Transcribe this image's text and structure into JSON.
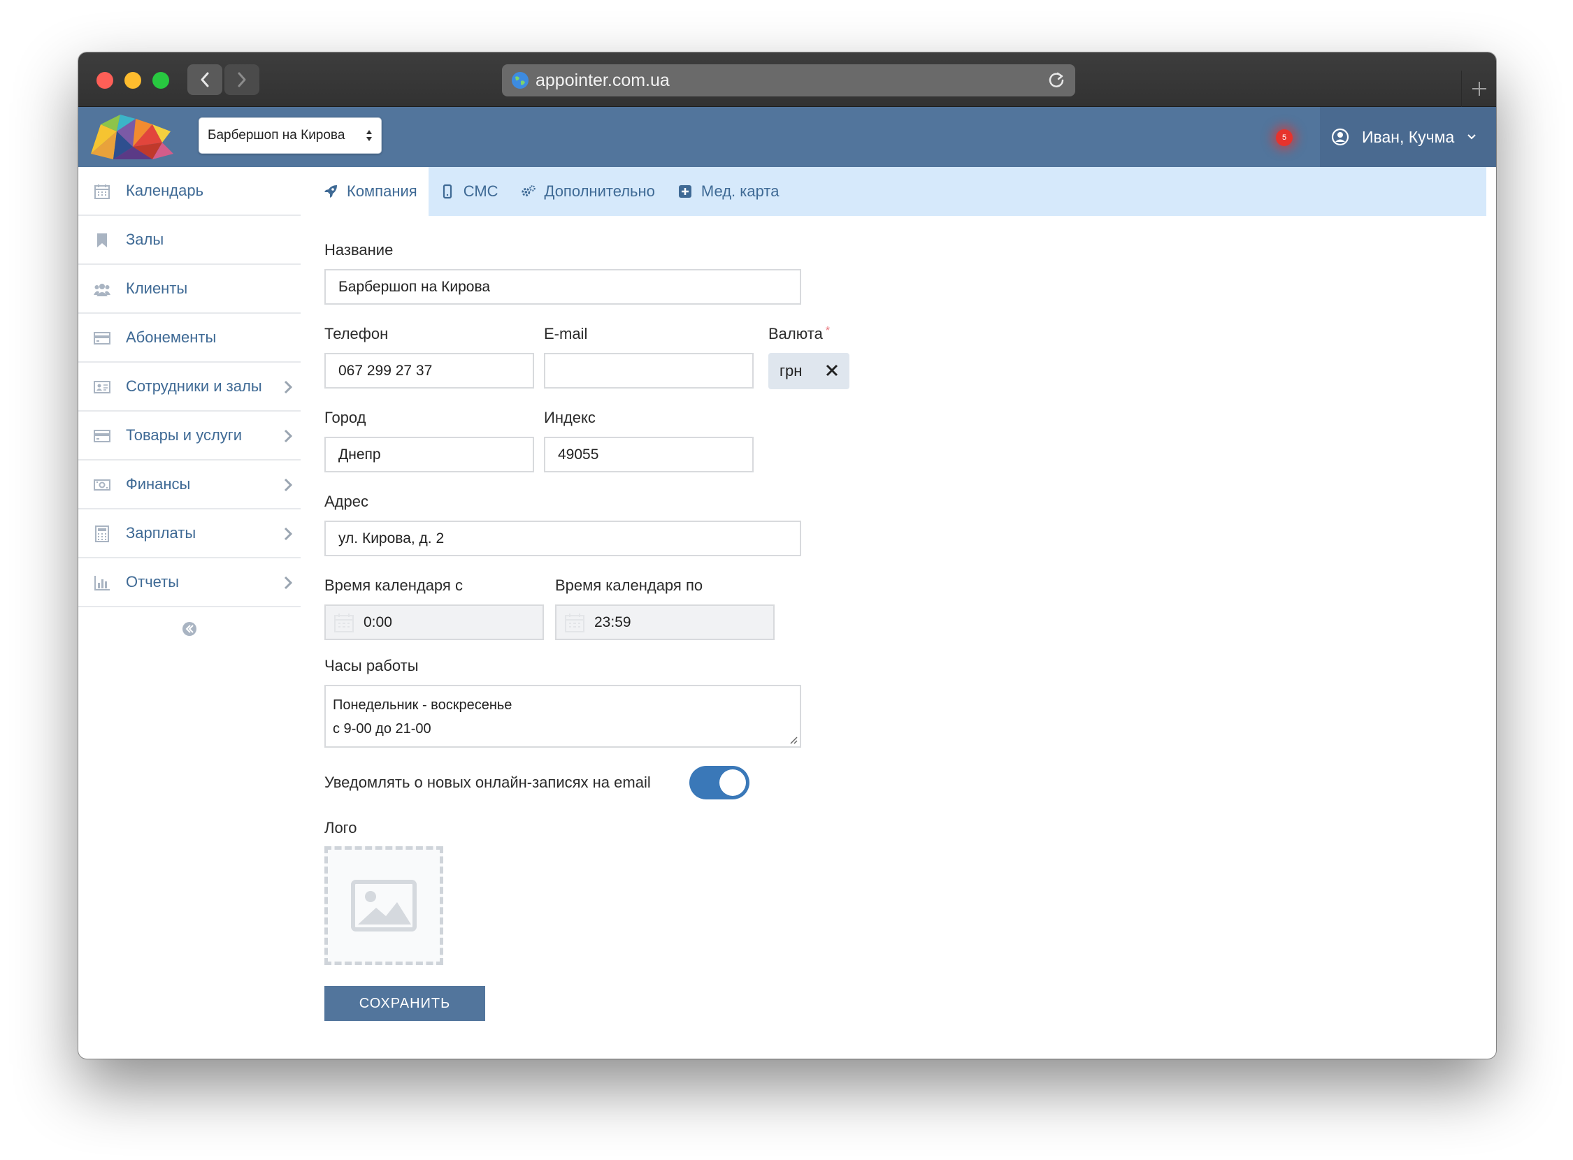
{
  "browser": {
    "url": "appointer.com.ua"
  },
  "header": {
    "company_select": "Барбершоп на Кирова",
    "notification_count": "5",
    "user_name": "Иван, Кучма"
  },
  "sidebar": {
    "items": [
      {
        "label": "Календарь",
        "icon": "calendar-icon",
        "has_arrow": false
      },
      {
        "label": "Залы",
        "icon": "bookmark-icon",
        "has_arrow": false
      },
      {
        "label": "Клиенты",
        "icon": "users-icon",
        "has_arrow": false
      },
      {
        "label": "Абонементы",
        "icon": "card-icon",
        "has_arrow": false
      },
      {
        "label": "Сотрудники и залы",
        "icon": "id-card-icon",
        "has_arrow": true
      },
      {
        "label": "Товары и услуги",
        "icon": "card-icon",
        "has_arrow": true
      },
      {
        "label": "Финансы",
        "icon": "money-icon",
        "has_arrow": true
      },
      {
        "label": "Зарплаты",
        "icon": "calculator-icon",
        "has_arrow": true
      },
      {
        "label": "Отчеты",
        "icon": "bar-chart-icon",
        "has_arrow": true
      }
    ]
  },
  "tabs": [
    {
      "label": "Компания",
      "icon": "rocket-icon",
      "active": true
    },
    {
      "label": "СМС",
      "icon": "mobile-icon",
      "active": false
    },
    {
      "label": "Дополнительно",
      "icon": "gears-icon",
      "active": false
    },
    {
      "label": "Мед. карта",
      "icon": "plus-square-icon",
      "active": false
    }
  ],
  "form": {
    "name_label": "Название",
    "name_value": "Барбершоп на Кирова",
    "phone_label": "Телефон",
    "phone_value": "067 299 27 37",
    "email_label": "E-mail",
    "email_value": "",
    "currency_label": "Валюта",
    "currency_required": "*",
    "currency_value": "грн",
    "city_label": "Город",
    "city_value": "Днепр",
    "zip_label": "Индекс",
    "zip_value": "49055",
    "address_label": "Адрес",
    "address_value": "ул. Кирова, д. 2",
    "cal_from_label": "Время календаря с",
    "cal_from_value": "0:00",
    "cal_to_label": "Время календаря по",
    "cal_to_value": "23:59",
    "hours_label": "Часы работы",
    "hours_line1": "Понедельник - воскресенье",
    "hours_line2": "с 9-00 до 21-00",
    "notify_label": "Уведомлять о новых онлайн-записях на email",
    "notify_enabled": true,
    "logo_label": "Лого",
    "save_label": "СОХРАНИТЬ"
  },
  "colors": {
    "header_bg": "#52759c",
    "tabs_bg": "#d6e9fb",
    "link_text": "#3f6a95",
    "toggle_on": "#3a78b8",
    "notification": "#e7332c"
  }
}
